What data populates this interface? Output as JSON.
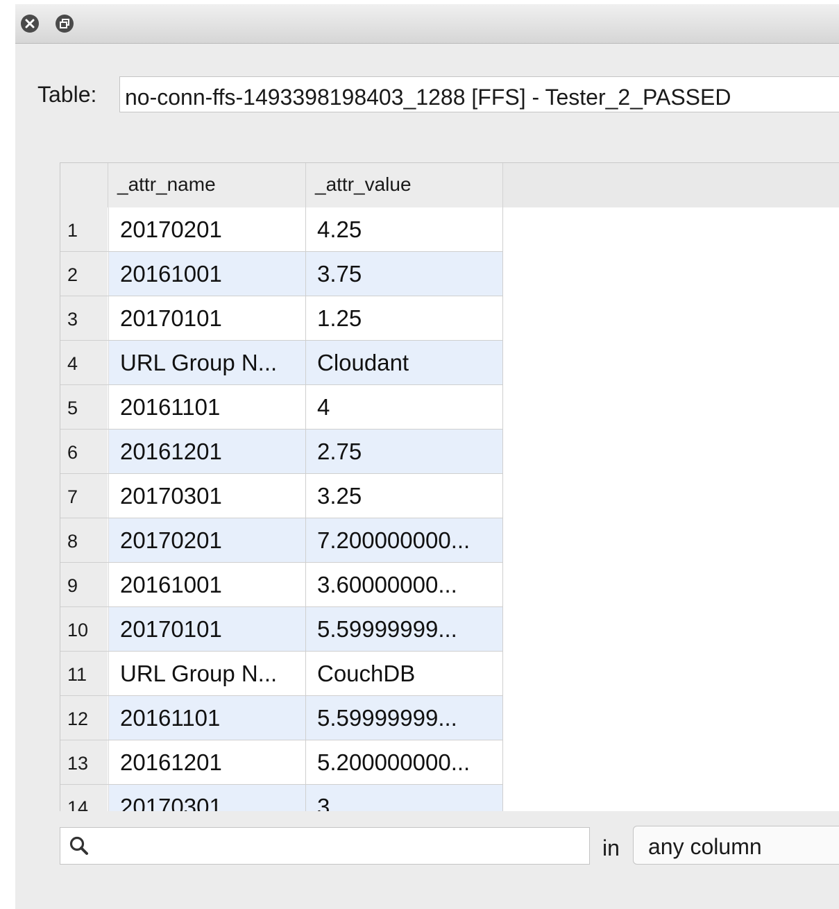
{
  "titlebar": {
    "close_icon": "close-icon",
    "restore_icon": "restore-icon"
  },
  "table_selector": {
    "label": "Table:",
    "value": "no-conn-ffs-1493398198403_1288 [FFS] - Tester_2_PASSED"
  },
  "grid": {
    "columns": [
      "_attr_name",
      "_attr_value"
    ],
    "rows": [
      {
        "num": "1",
        "name": "20170201",
        "value": "4.25"
      },
      {
        "num": "2",
        "name": "20161001",
        "value": "3.75"
      },
      {
        "num": "3",
        "name": "20170101",
        "value": "1.25"
      },
      {
        "num": "4",
        "name": "URL Group N...",
        "value": "Cloudant"
      },
      {
        "num": "5",
        "name": "20161101",
        "value": "4"
      },
      {
        "num": "6",
        "name": "20161201",
        "value": "2.75"
      },
      {
        "num": "7",
        "name": "20170301",
        "value": "3.25"
      },
      {
        "num": "8",
        "name": "20170201",
        "value": "7.200000000..."
      },
      {
        "num": "9",
        "name": "20161001",
        "value": "3.60000000..."
      },
      {
        "num": "10",
        "name": "20170101",
        "value": "5.59999999..."
      },
      {
        "num": "11",
        "name": "URL Group N...",
        "value": "CouchDB"
      },
      {
        "num": "12",
        "name": "20161101",
        "value": "5.59999999..."
      },
      {
        "num": "13",
        "name": "20161201",
        "value": "5.200000000..."
      },
      {
        "num": "14",
        "name": "20170301",
        "value": "3"
      }
    ]
  },
  "filter": {
    "search_value": "",
    "in_label": "in",
    "column_selected": "any column"
  }
}
